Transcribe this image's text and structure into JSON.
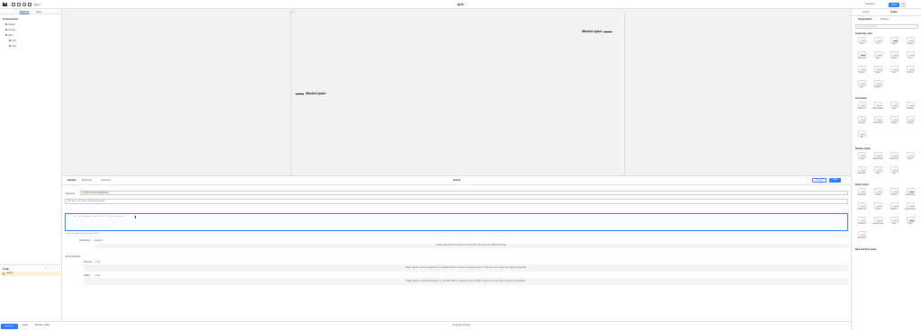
{
  "topbar": {
    "app_name": "Apps",
    "page_title": "tyrt1",
    "release_label": "Releases",
    "share_label": "Share",
    "more_label": "▾"
  },
  "left_panel": {
    "tabs": [
      "Explorer",
      "State"
    ],
    "components_heading": "Components",
    "tree": [
      "Header",
      "Content",
      "Main",
      "tyrt1",
      "tyrt2"
    ],
    "code_heading": "Code",
    "query_item": "query1"
  },
  "canvas": {
    "wasted_left": "Wasted space",
    "wasted_right": "Wasted space"
  },
  "query_editor": {
    "tabs": [
      "General",
      "Response",
      "Advanced"
    ],
    "title": "query1",
    "preview_label": "Preview",
    "save_label": "Save",
    "resource_label": "Resource",
    "resource_value": "Run JS Code (javascript)",
    "resource_hint": "Run query only when manually triggered",
    "code_line": "1   // Use code debugger which will fix your function",
    "line_number_2": "2",
    "learn_more": "Learn more about Javascript queries here.",
    "transformer_label": "Transformer",
    "transformer_toggle": "Disabled",
    "transformer_text": "Enable transformers to transform the result of the query to a different format.",
    "event_handlers_label": "Event handlers",
    "success_label": "Success",
    "success_add": "+ Add",
    "success_text": "Trigger queries, control components, or call other APIs in response to query success. These are not run when the query is previewed.",
    "failure_label": "Failure",
    "failure_add": "+ Add",
    "failure_text": "Trigger queries, control components, or call other APIs in response to query failure. These are not run when the query is previewed."
  },
  "right_panel": {
    "tabs": [
      "Inspect",
      "Create"
    ],
    "subtabs": [
      "Components",
      "Modules"
    ],
    "search_placeholder": "Search components",
    "sections": [
      {
        "title": "Commonly used",
        "items": [
          "Table",
          "Text",
          "Button",
          "Text input",
          "Number input",
          "Select",
          "Container",
          "Form",
          "Checkbox",
          "Keyvalue",
          "Chart",
          "Key, Value",
          "Image",
          "Navigation"
        ]
      },
      {
        "title": "Text inputs",
        "items": [
          "Editable Text",
          "Editable Text Area",
          "Email",
          "JSON Editor",
          "Password",
          "Rich Text Editor",
          "Text Area",
          "Text Input",
          "URL"
        ]
      },
      {
        "title": "Number inputs",
        "items": [
          "Currency",
          "Editable Number",
          "Number Input",
          "Percent",
          "Range Slider",
          "Rating",
          "Slider"
        ]
      },
      {
        "title": "Select inputs",
        "items": [
          "Button Group",
          "Cascader",
          "Checkbox",
          "Checkbox Group",
          "Checkbox Tree",
          "Listbox",
          "Multiselect",
          "Multiselect Listbox",
          "Radio Group",
          "Segmented Control",
          "Select",
          "Switch",
          "Switch Group"
        ]
      },
      {
        "title": "Date and time inputs",
        "items": []
      }
    ]
  },
  "statusbar": {
    "mode_label": "production",
    "latest_label": "Latest",
    "runtime_label": "Runtime: Latest",
    "status_text": "No queries running"
  }
}
